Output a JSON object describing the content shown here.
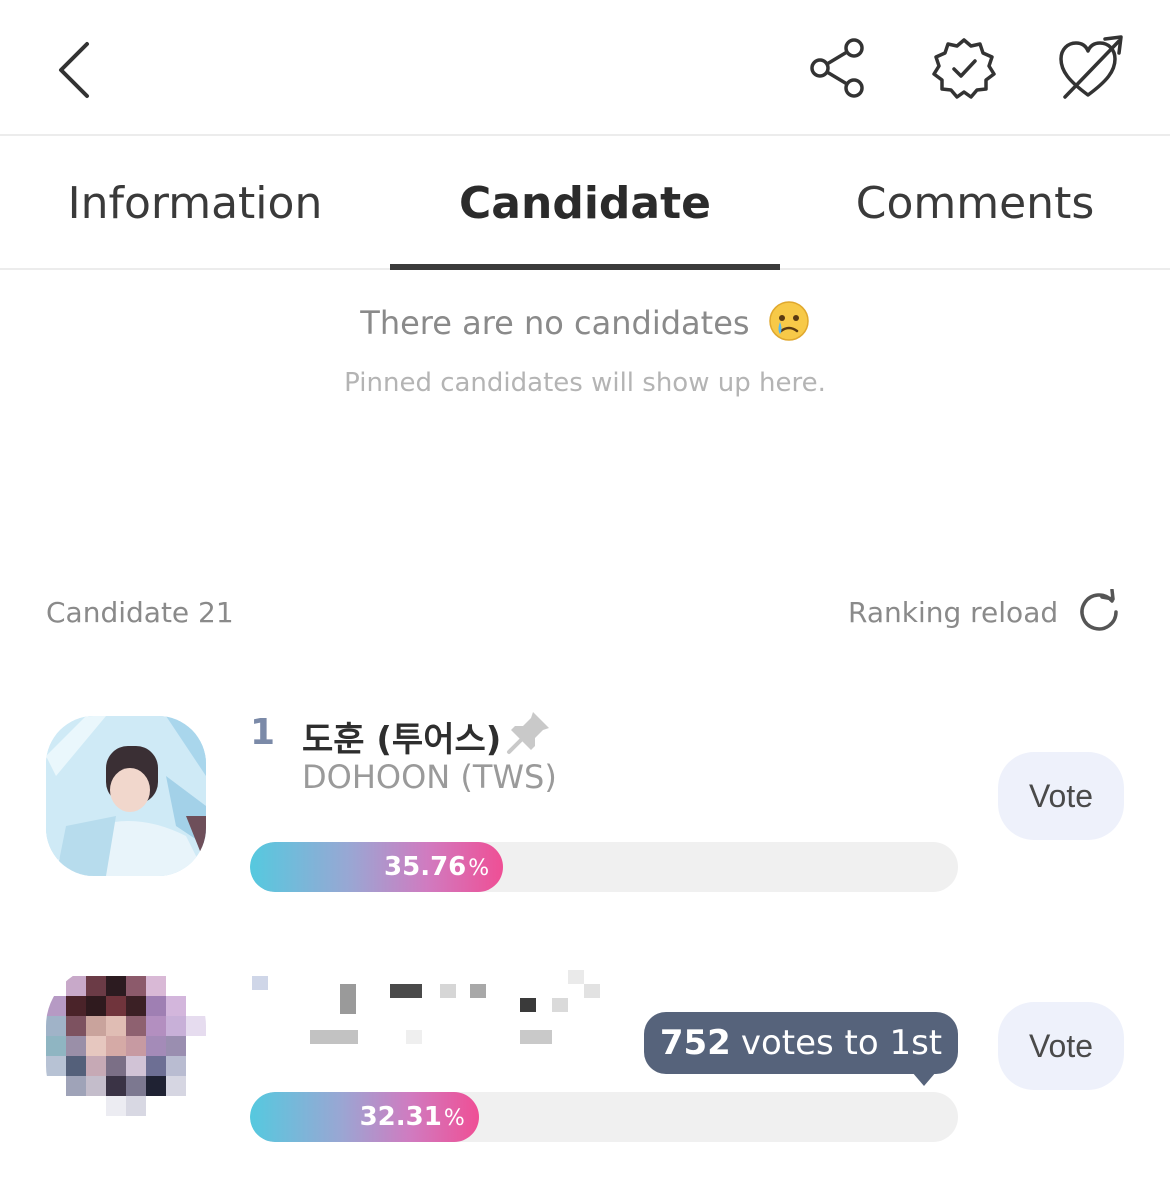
{
  "header": {
    "back_icon": "chevron-left-icon",
    "share_icon": "share-icon",
    "badge_icon": "verified-badge-icon",
    "heart_icon": "heart-arrow-icon"
  },
  "tabs": [
    {
      "label": "Information",
      "active": false
    },
    {
      "label": "Candidate",
      "active": true
    },
    {
      "label": "Comments",
      "active": false
    }
  ],
  "empty_state": {
    "title": "There are no candidates",
    "emoji": "crying-face-icon",
    "subtitle": "Pinned candidates will show up here."
  },
  "candidate_list": {
    "count_label": "Candidate 21",
    "reload_label": "Ranking reload",
    "items": [
      {
        "rank": "1",
        "name_ko": "도훈 (투어스)",
        "name_en": "DOHOON (TWS)",
        "percent": "35.76",
        "percent_value": 35.76,
        "percent_sign": "%",
        "vote_label": "Vote"
      },
      {
        "percent": "32.31",
        "percent_value": 32.31,
        "percent_sign": "%",
        "vote_label": "Vote",
        "gap_number": "752",
        "gap_text": "votes to 1st"
      }
    ]
  },
  "colors": {
    "bar_start": "#55c9df",
    "bar_end": "#ef4f95",
    "vote_bg": "#eef1fb",
    "tooltip_bg": "#56637b",
    "rank_color": "#7b8aa8"
  }
}
